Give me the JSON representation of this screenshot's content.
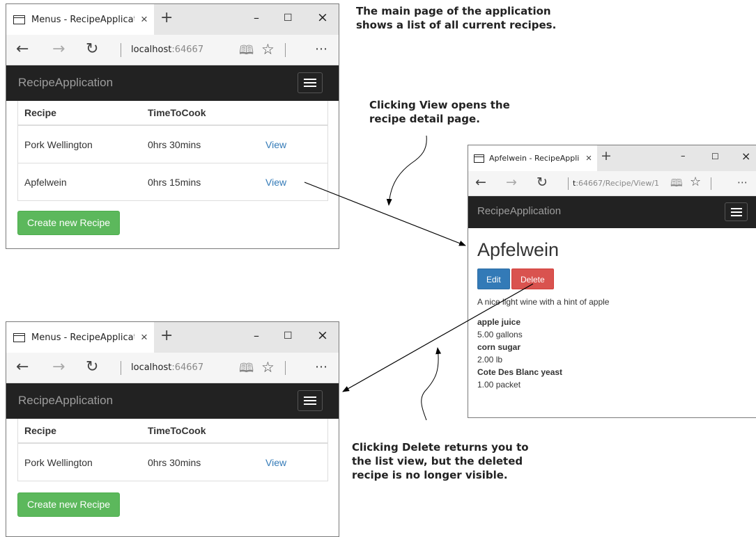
{
  "window_main": {
    "tab_title": "Menus - RecipeApplicat",
    "url_host": "localhost",
    "url_port": ":64667",
    "brand": "RecipeApplication",
    "table": {
      "headers": [
        "Recipe",
        "TimeToCook",
        ""
      ],
      "rows": [
        {
          "recipe": "Pork Wellington",
          "time": "0hrs 30mins",
          "action": "View"
        },
        {
          "recipe": "Apfelwein",
          "time": "0hrs 15mins",
          "action": "View"
        }
      ]
    },
    "create_button": "Create new Recipe"
  },
  "window_detail": {
    "tab_title": "Apfelwein - RecipeAppli",
    "url_host": "t",
    "url_rest": ":64667/Recipe/View/1",
    "brand": "RecipeApplication",
    "heading": "Apfelwein",
    "edit_button": "Edit",
    "delete_button": "Delete",
    "description": "A nice light wine with a hint of apple",
    "ingredients": [
      {
        "name": "apple juice",
        "amount": "5.00 gallons"
      },
      {
        "name": "corn sugar",
        "amount": "2.00 lb"
      },
      {
        "name": "Cote Des Blanc yeast",
        "amount": "1.00 packet"
      }
    ]
  },
  "window_after": {
    "tab_title": "Menus - RecipeApplicat",
    "url_host": "localhost",
    "url_port": ":64667",
    "brand": "RecipeApplication",
    "table": {
      "headers": [
        "Recipe",
        "TimeToCook",
        ""
      ],
      "rows": [
        {
          "recipe": "Pork Wellington",
          "time": "0hrs 30mins",
          "action": "View"
        }
      ]
    },
    "create_button": "Create new Recipe"
  },
  "captions": {
    "main": [
      "The main page of the application",
      "shows a list of all current recipes."
    ],
    "view": [
      "Clicking View opens the",
      "recipe detail page."
    ],
    "delete": [
      "Clicking Delete returns you to",
      "the list view, but the deleted",
      "recipe is no longer visible."
    ]
  },
  "browser_glyphs": {
    "new_tab": "+",
    "close": "×",
    "minimize": "–",
    "maximize": "☐",
    "close_window": "×",
    "back": "←",
    "forward": "→",
    "refresh": "↻",
    "reading_view": "🕮",
    "favorite": "☆",
    "more": "⋯"
  },
  "colors": {
    "navbar_dark": "#222222",
    "brand_text": "#9d9d9d",
    "link": "#337ab7",
    "btn_success": "#5cb85c",
    "btn_primary": "#337ab7",
    "btn_danger": "#d9534f"
  }
}
